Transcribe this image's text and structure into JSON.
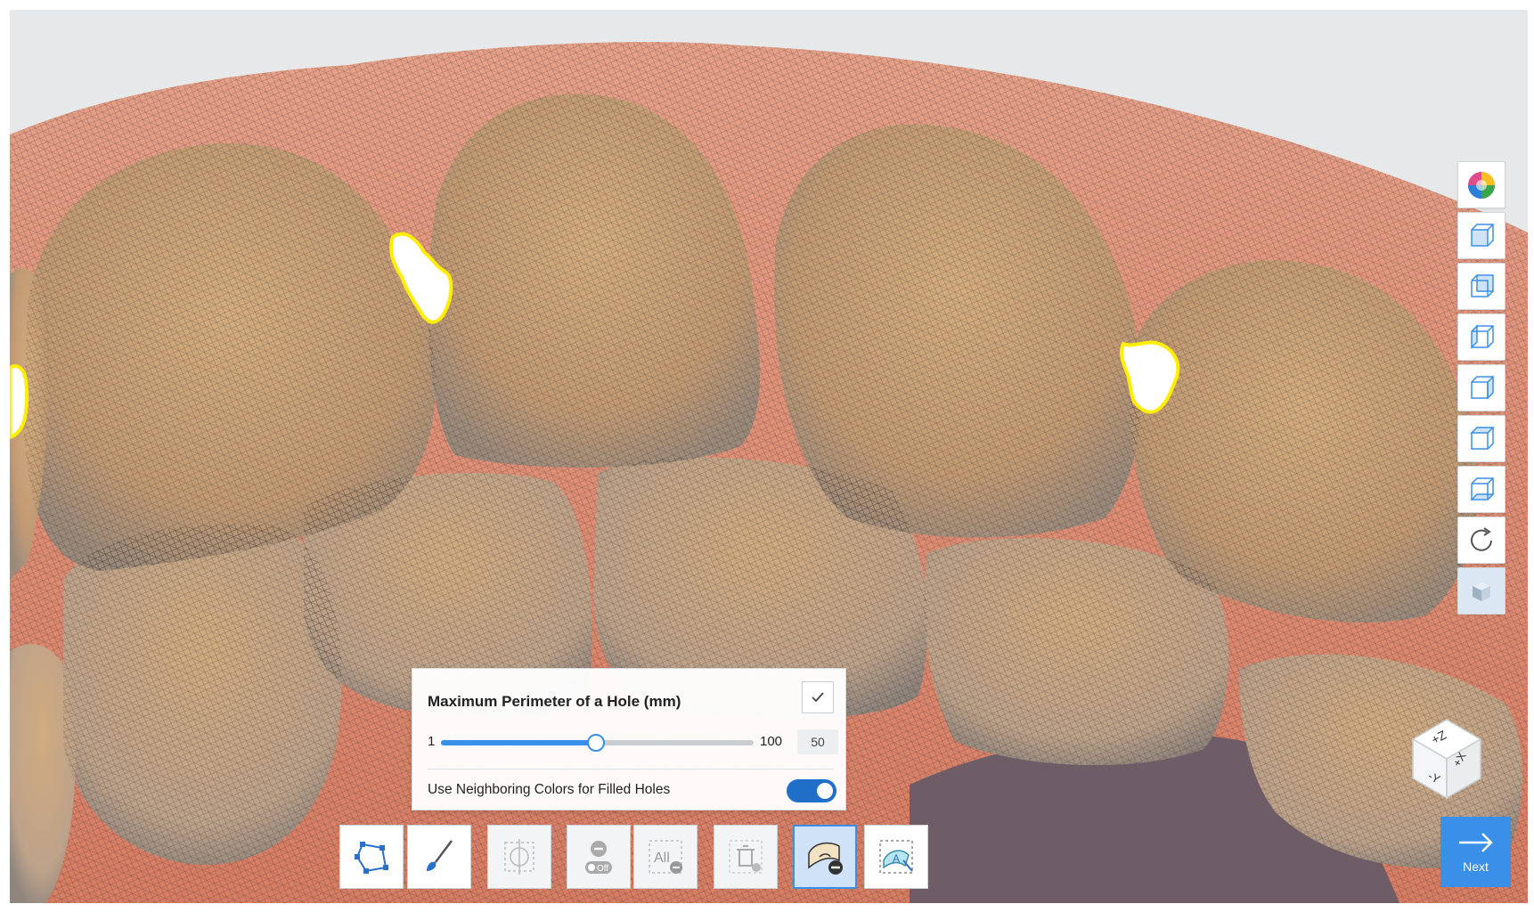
{
  "panel": {
    "title": "Maximum Perimeter of a Hole (mm)",
    "slider": {
      "min_label": "1",
      "max_label": "100",
      "value": "50",
      "min": 1,
      "max": 100,
      "current": 50
    },
    "toggle_label": "Use Neighboring Colors for Filled Holes",
    "toggle_on": true
  },
  "next_button": {
    "label": "Next"
  },
  "nav_cube": {
    "labels": [
      "+Z",
      "-Y",
      "+X"
    ]
  },
  "bottom_toolbar": {
    "buttons": [
      {
        "name": "polygon-select-tool",
        "icon": "polygon-icon",
        "state": "normal"
      },
      {
        "name": "brush-select-tool",
        "icon": "brush-icon",
        "state": "normal"
      },
      {
        "name": "through-select-tool",
        "icon": "through-select-icon",
        "state": "disabled"
      },
      {
        "name": "hole-toggle-off",
        "icon": "minus-off-icon",
        "state": "disabled",
        "off_label": "Off"
      },
      {
        "name": "deselect-all",
        "icon": "all-deselect-icon",
        "state": "disabled",
        "all_label": "All"
      },
      {
        "name": "delete-selection",
        "icon": "trash-icon",
        "state": "disabled"
      },
      {
        "name": "fill-holes-tool",
        "icon": "fill-holes-icon",
        "state": "active"
      },
      {
        "name": "smart-fill-tool",
        "icon": "smart-fill-icon",
        "state": "normal"
      }
    ]
  },
  "side_toolbar": {
    "buttons": [
      "color-mode-icon",
      "view-front-icon",
      "view-back-icon",
      "view-left-icon",
      "view-right-icon",
      "view-top-icon",
      "view-bottom-icon",
      "reset-view-icon",
      "texture-toggle-icon"
    ]
  },
  "colors": {
    "accent": "#3a8fe8",
    "hole_outline": "#ffee00",
    "gum": "#d9836a",
    "tooth": "#caa882",
    "background": "#e6e8e9"
  }
}
